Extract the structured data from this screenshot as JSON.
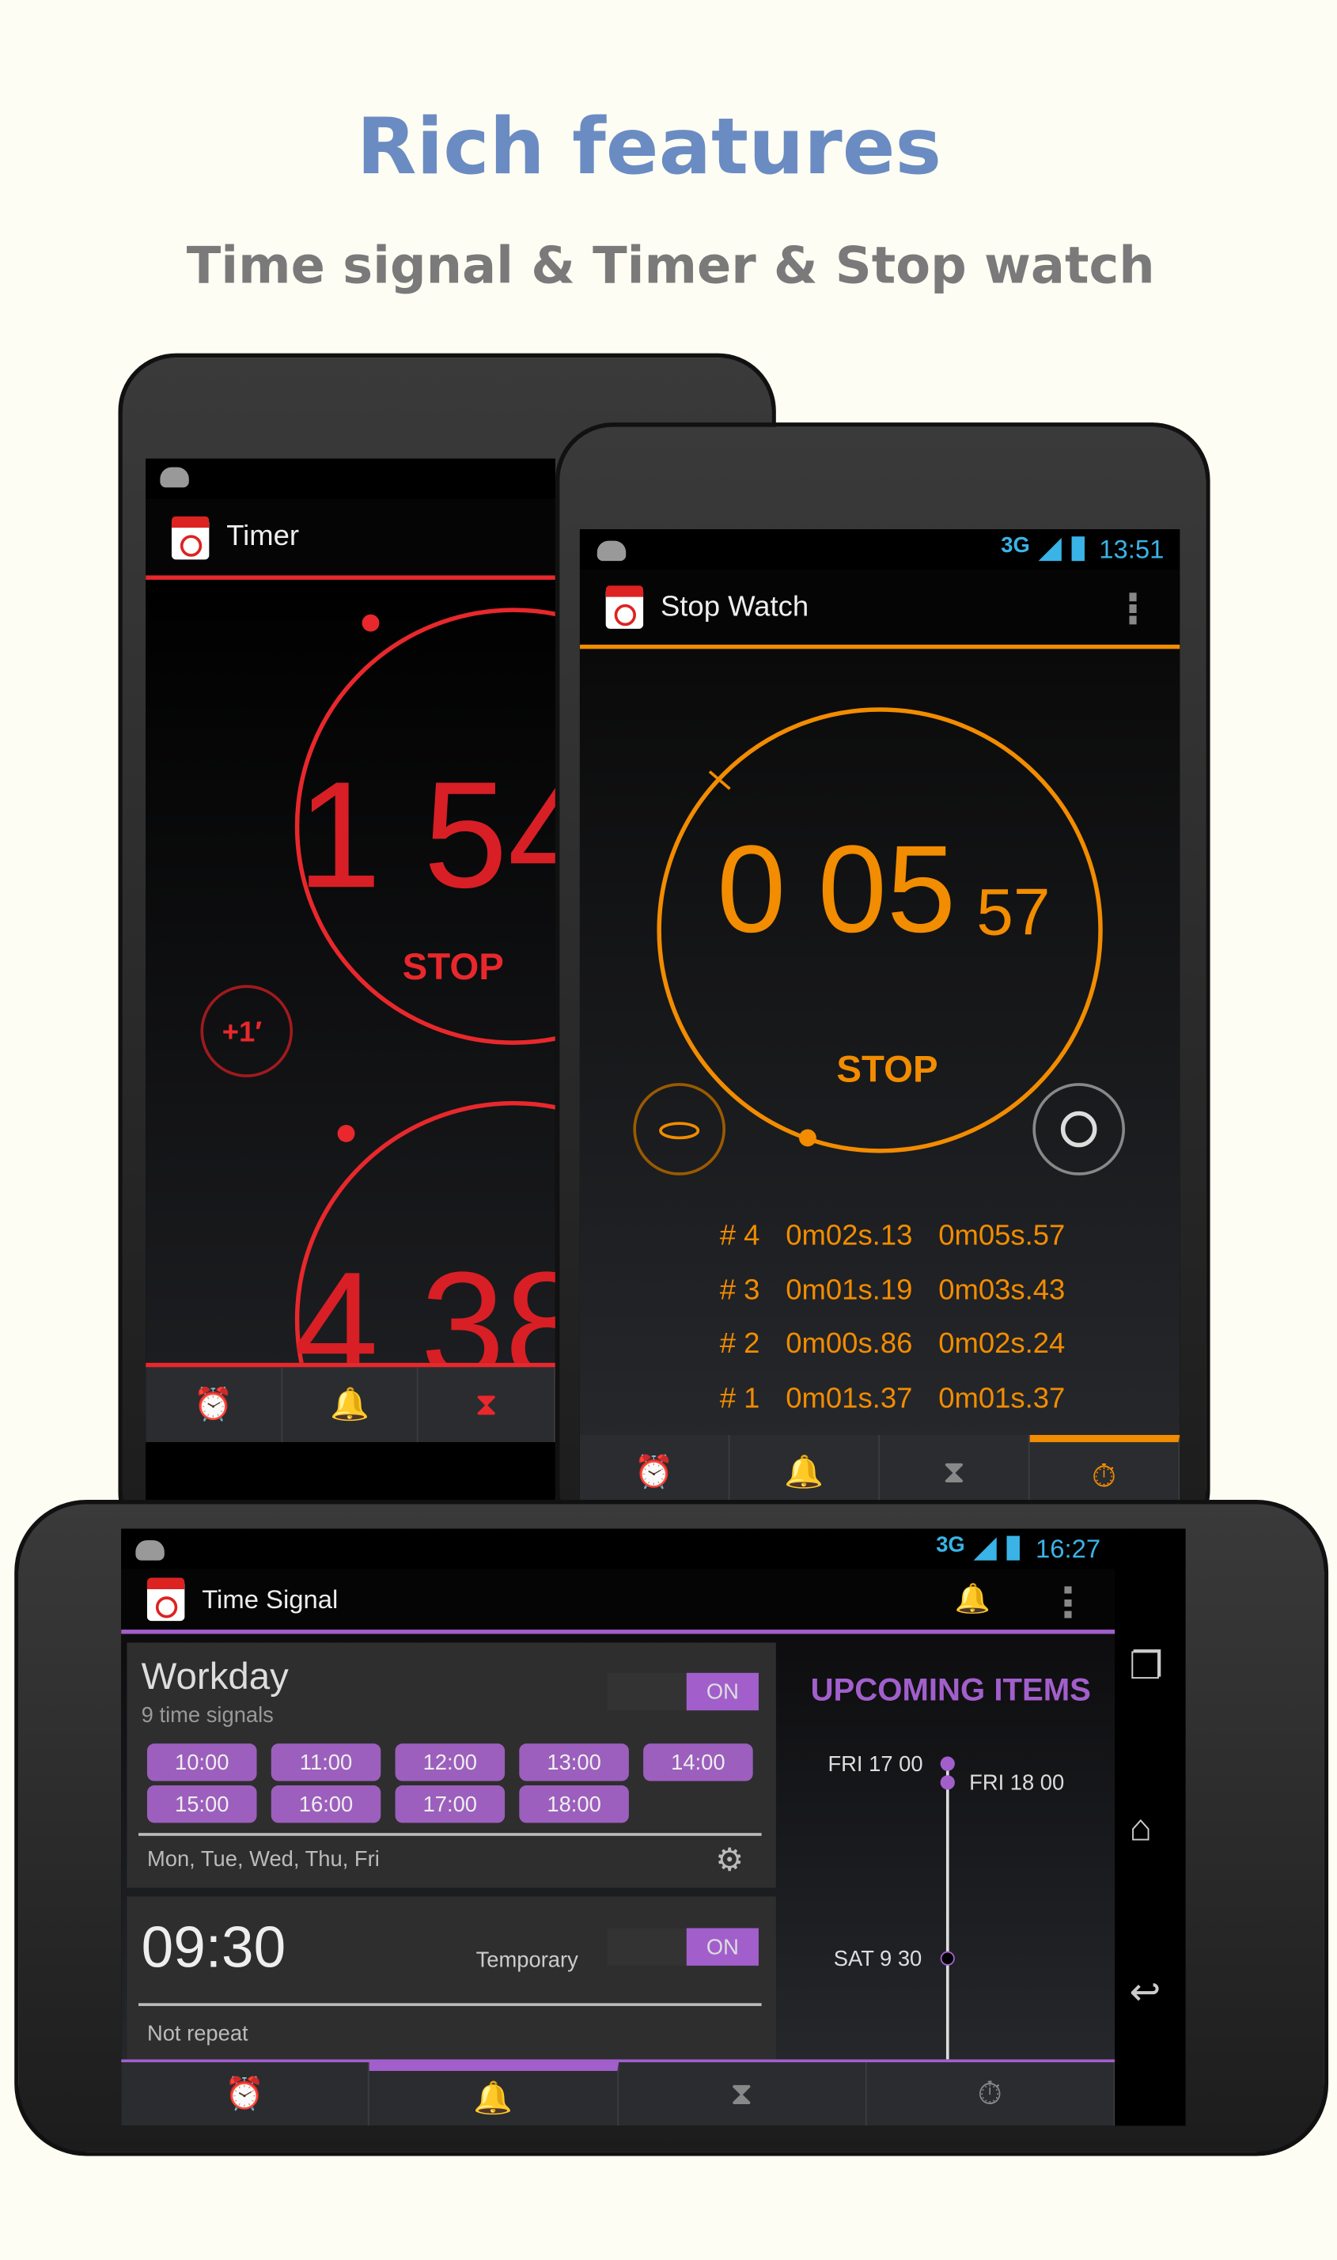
{
  "header": {
    "title": "Rich features",
    "subtitle": "Time signal & Timer & Stop watch"
  },
  "colors": {
    "timer": "#e8282c",
    "stopwatch": "#f28c00",
    "timesignal": "#a25fcc",
    "title": "#6b8cc2"
  },
  "timer": {
    "title": "Timer",
    "digits1": "1 54",
    "stop": "STOP",
    "plus": "+1′",
    "digits2": "4 38",
    "tabs": [
      "alarm-icon",
      "bell-icon",
      "hourglass-icon"
    ]
  },
  "stopwatch": {
    "status_time": "13:51",
    "network": "3G",
    "title": "Stop Watch",
    "minutes": "0",
    "seconds": "05",
    "hundredths": "57",
    "stop": "STOP",
    "laps": [
      {
        "n": "# 4",
        "lap": "0m02s.13",
        "total": "0m05s.57"
      },
      {
        "n": "# 3",
        "lap": "0m01s.19",
        "total": "0m03s.43"
      },
      {
        "n": "# 2",
        "lap": "0m00s.86",
        "total": "0m02s.24"
      },
      {
        "n": "# 1",
        "lap": "0m01s.37",
        "total": "0m01s.37"
      }
    ],
    "tabs": [
      "alarm-icon",
      "bell-icon",
      "hourglass-icon",
      "stopwatch-icon"
    ],
    "active_tab": 3
  },
  "timesignal": {
    "status_time": "16:27",
    "network": "3G",
    "title": "Time Signal",
    "card1": {
      "name": "Workday",
      "count": "9 time signals",
      "toggle": "ON",
      "times": [
        "10:00",
        "11:00",
        "12:00",
        "13:00",
        "14:00",
        "15:00",
        "16:00",
        "17:00",
        "18:00"
      ],
      "days": "Mon, Tue, Wed, Thu, Fri"
    },
    "card2": {
      "time": "09:30",
      "type": "Temporary",
      "toggle": "ON",
      "repeat": "Not repeat"
    },
    "upcoming": {
      "title": "UPCOMING ITEMS",
      "items": [
        "FRI 17 00",
        "FRI 18 00",
        "SAT 9 30"
      ]
    },
    "tabs": [
      "alarm-icon",
      "bell-icon",
      "hourglass-icon",
      "stopwatch-icon"
    ],
    "active_tab": 1
  }
}
